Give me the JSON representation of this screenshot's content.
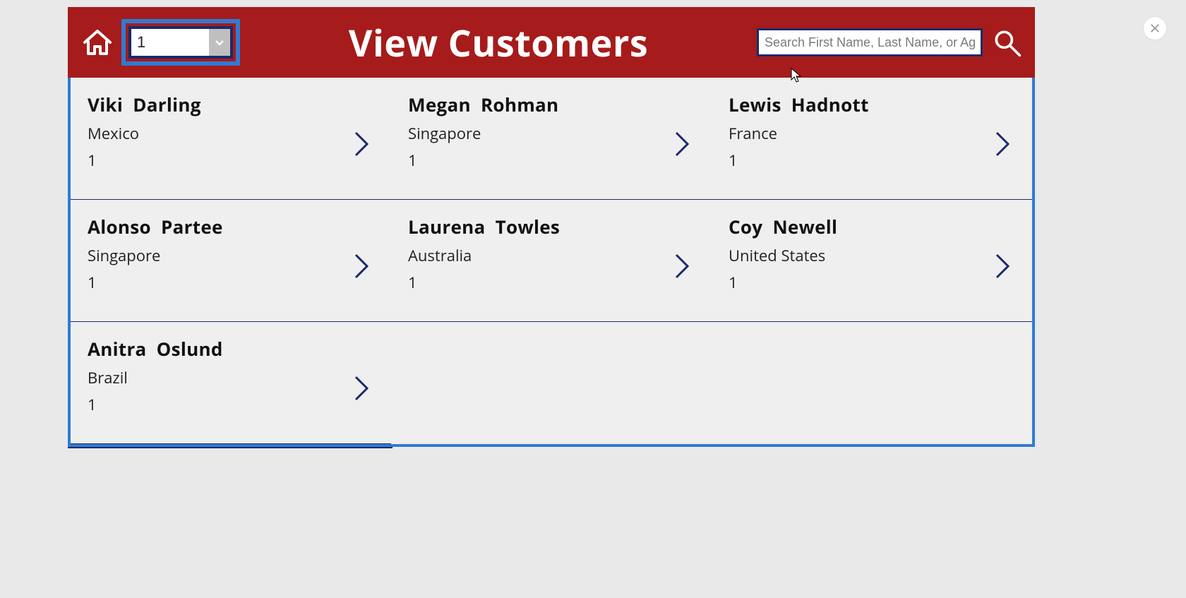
{
  "header": {
    "title": "View Customers",
    "page_value": "1",
    "search_placeholder": "Search First Name, Last Name, or Age"
  },
  "customers": [
    {
      "first": "Viki",
      "last": "Darling",
      "country": "Mexico",
      "num": "1"
    },
    {
      "first": "Megan",
      "last": "Rohman",
      "country": "Singapore",
      "num": "1"
    },
    {
      "first": "Lewis",
      "last": "Hadnott",
      "country": "France",
      "num": "1"
    },
    {
      "first": "Alonso",
      "last": "Partee",
      "country": "Singapore",
      "num": "1"
    },
    {
      "first": "Laurena",
      "last": "Towles",
      "country": "Australia",
      "num": "1"
    },
    {
      "first": "Coy",
      "last": "Newell",
      "country": "United States",
      "num": "1"
    },
    {
      "first": "Anitra",
      "last": "Oslund",
      "country": "Brazil",
      "num": "1"
    }
  ],
  "colors": {
    "brand": "#a61b1b",
    "accent": "#1b2a6b",
    "highlight": "#2f7bd3"
  }
}
